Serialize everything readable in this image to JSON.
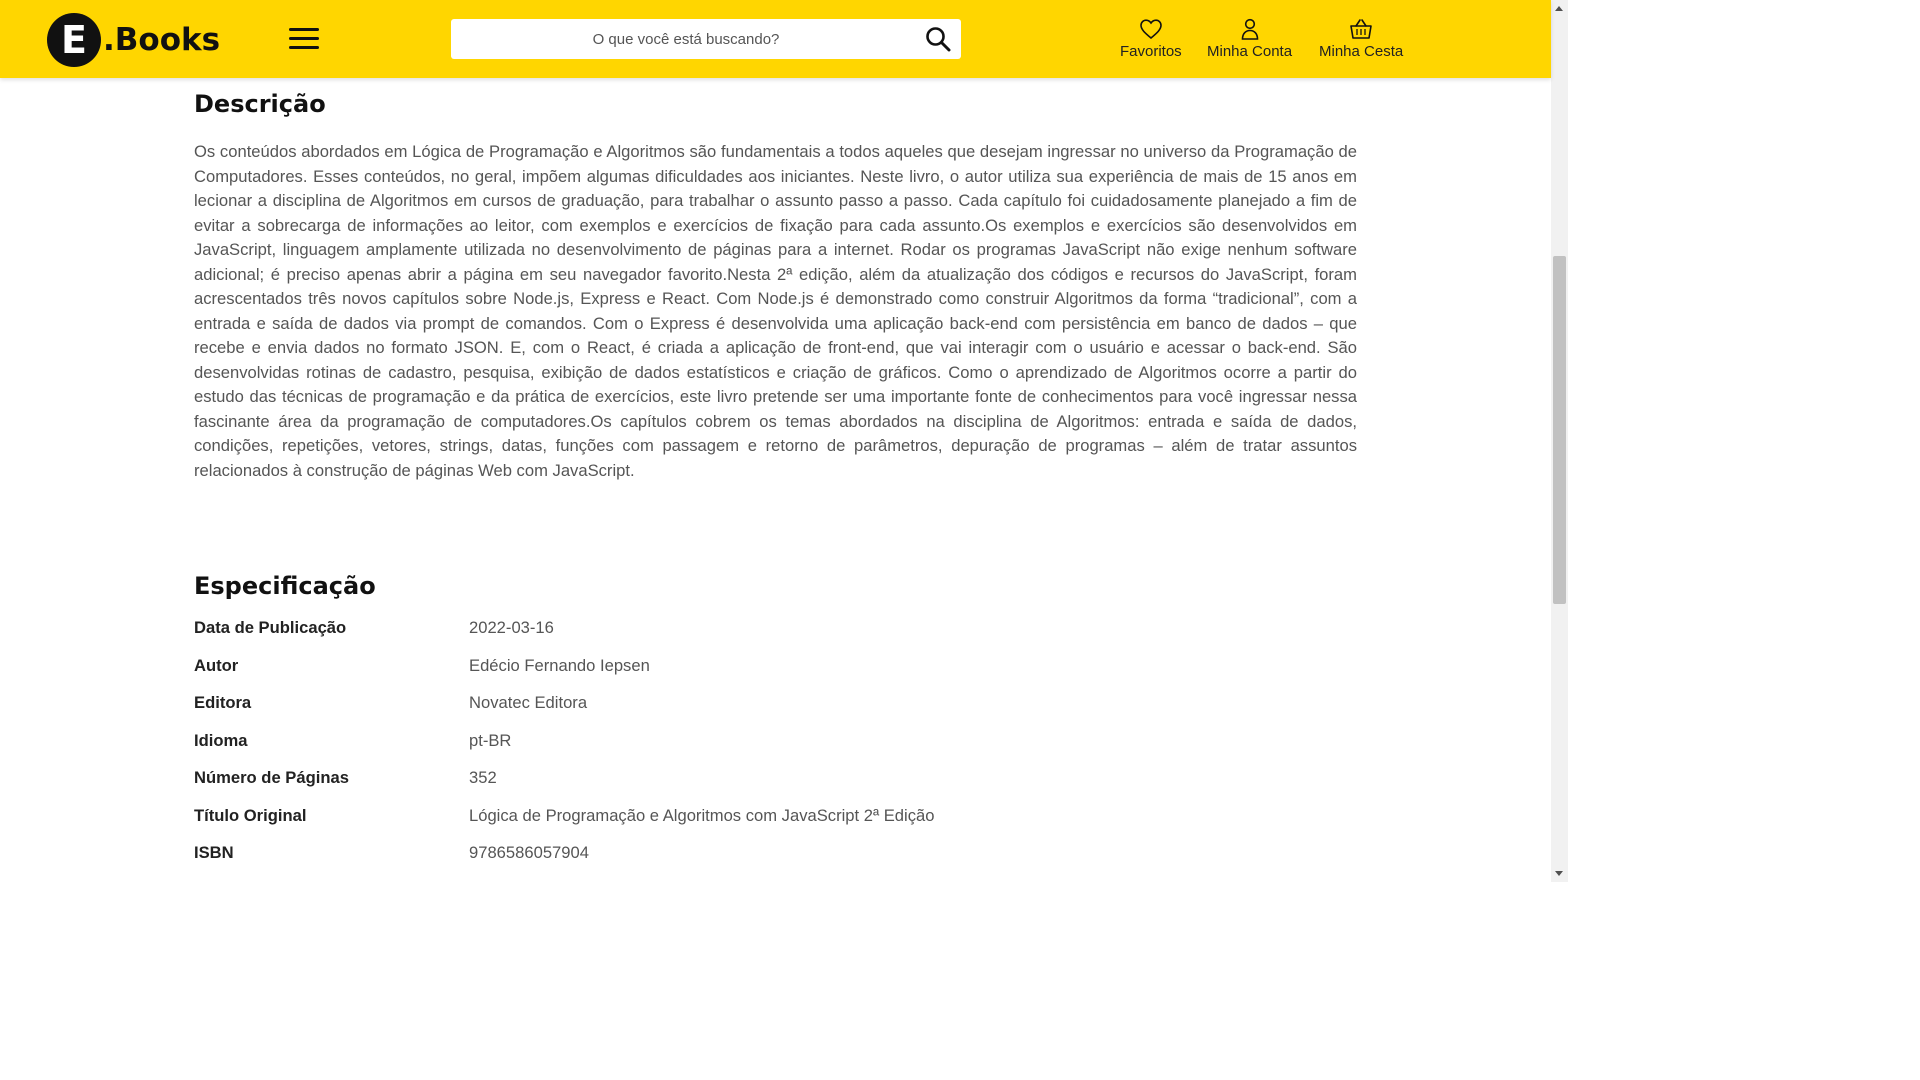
{
  "header": {
    "logo_letter": "E",
    "logo_text": ".Books",
    "search_placeholder": "O que você está buscando?",
    "nav": [
      {
        "label": "Favoritos",
        "icon": "heart-icon"
      },
      {
        "label": "Minha Conta",
        "icon": "user-icon"
      },
      {
        "label": "Minha Cesta",
        "icon": "basket-icon"
      }
    ],
    "brand_color": "#FFD600"
  },
  "description": {
    "title": "Descrição",
    "text": "Os conteúdos abordados em Lógica de Programação e Algoritmos são fundamentais a todos aqueles que desejam ingressar no universo da Programação de Computadores. Esses conteúdos, no geral, impõem algumas dificuldades aos iniciantes. Neste livro, o autor utiliza sua experiência de mais de 15 anos em lecionar a disciplina de Algoritmos em cursos de graduação, para trabalhar o assunto passo a passo. Cada capítulo foi cuidadosamente planejado a fim de evitar a sobrecarga de informações ao leitor, com exemplos e exercícios de fixação para cada assunto.Os exemplos e exercícios são desenvolvidos em JavaScript, linguagem amplamente utilizada no desenvolvimento de páginas para a internet. Rodar os programas JavaScript não exige nenhum software adicional; é preciso apenas abrir a página em seu navegador favorito.Nesta 2ª edição, além da atualização dos códigos e recursos do JavaScript, foram acrescentados três novos capítulos sobre Node.js, Express e React. Com Node.js é demonstrado como construir Algoritmos da forma “tradicional”, com a entrada e saída de dados via prompt de comandos. Com o Express é desenvolvida uma aplicação back-end com persistência em banco de dados – que recebe e envia dados no formato JSON. E, com o React, é criada a aplicação de front-end, que vai interagir com o usuário e acessar o back-end. São desenvolvidas rotinas de cadastro, pesquisa, exibição de dados estatísticos e criação de gráficos.  Como o aprendizado de Algoritmos ocorre a partir do estudo das técnicas de programação e da prática de exercícios, este livro pretende ser uma importante fonte de conhecimentos para você ingressar nessa fascinante área da programação de computadores.Os capítulos cobrem os temas abordados na disciplina de Algoritmos: entrada e saída de dados, condições, repetições, vetores, strings, datas, funções com passagem e retorno de parâmetros, depuração de programas – além de tratar assuntos relacionados à construção de páginas Web com JavaScript."
  },
  "specification": {
    "title": "Especificação",
    "rows": [
      {
        "label": "Data de Publicação",
        "value": "2022-03-16"
      },
      {
        "label": "Autor",
        "value": "Edécio Fernando Iepsen"
      },
      {
        "label": "Editora",
        "value": "Novatec Editora"
      },
      {
        "label": "Idioma",
        "value": "pt-BR"
      },
      {
        "label": "Número de Páginas",
        "value": "352"
      },
      {
        "label": "Título Original",
        "value": "Lógica de Programação e Algoritmos com JavaScript 2ª Edição"
      },
      {
        "label": "ISBN",
        "value": "9786586057904"
      }
    ]
  }
}
